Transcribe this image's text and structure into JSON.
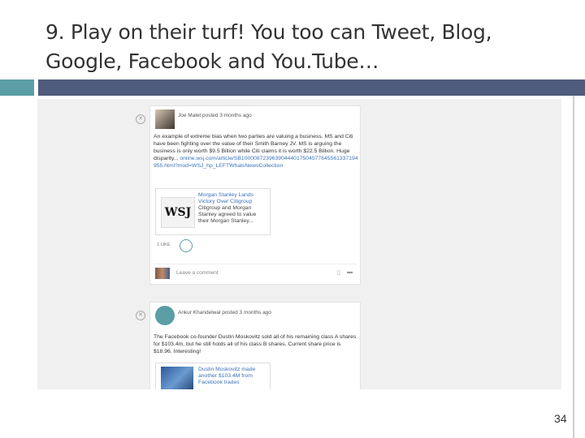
{
  "slide": {
    "title": "9. Play on their turf! You too can Tweet, Blog, Google, Facebook and You.Tube…",
    "page_number": "34"
  },
  "posts": [
    {
      "author": "Joe Malet posted 3 months ago",
      "text": "An example of extreme bias when two parties are valuing a business. MS and Citi have been fighting over the value of their Smith Barney JV. MS is arguing the business is only worth $9.5 Billion while Citi claims it is worth $22.5 Billion. Huge disparity...",
      "link": "online.wsj.com/article/SB10000872396390444017504577645561337194955.html?mod=WSJ_hp_LEFTWhatsNewsCollection",
      "preview": {
        "thumb_text": "WSJ",
        "title": "Morgan Stanley Lands Victory Over Citigroup",
        "description": "Citigroup and Morgan Stanley agreed to value their Morgan Stanley..."
      },
      "like_label": "1 LIKE",
      "comment_placeholder": "Leave a comment"
    },
    {
      "author": "Ankur Khandelwal posted 3 months ago",
      "text": "The Facebook co-founder Dustin Moskovitz sold all of his remaining class A shares for $103.4m, but he still holds all of his class B shares. Current share price is $18.96. Interesting!",
      "preview": {
        "title": "Dustin Moskovitz made another $103.4M from Facebook trades"
      }
    }
  ],
  "colors": {
    "accent_teal": "#5b9ea6",
    "accent_navy": "#4f5c7d",
    "link_blue": "#3b73b9"
  }
}
